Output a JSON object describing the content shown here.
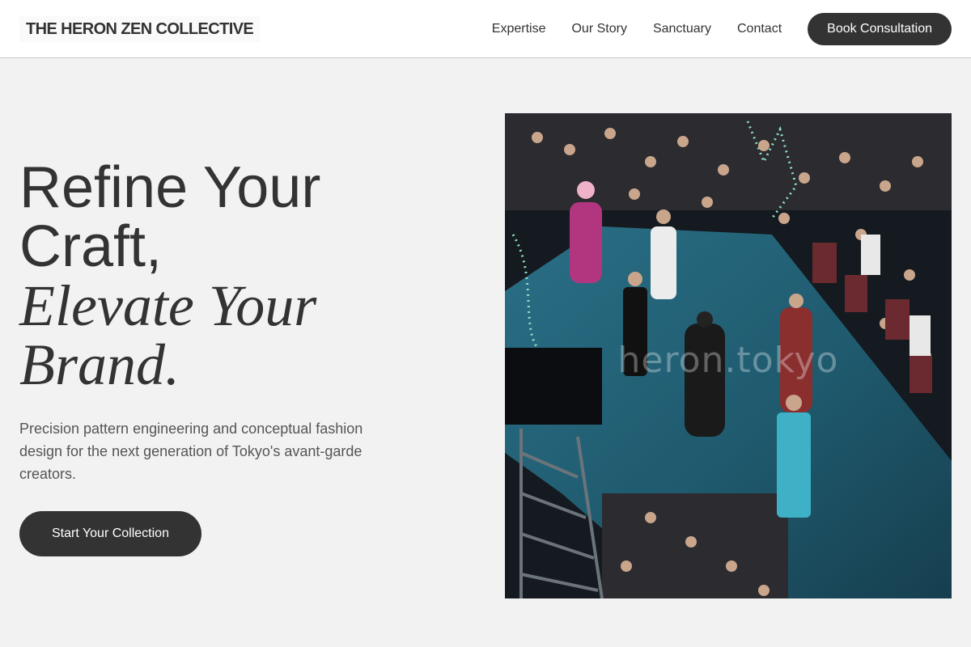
{
  "header": {
    "brand": "THE HERON ZEN COLLECTIVE",
    "nav": [
      "Expertise",
      "Our Story",
      "Sanctuary",
      "Contact"
    ],
    "cta_label": "Book Consultation"
  },
  "hero": {
    "headline_line1": "Refine Your Craft,",
    "headline_line2": "Elevate Your Brand.",
    "description": "Precision pattern engineering and conceptual fashion design for the next generation of Tokyo's avant-garde creators.",
    "cta_label": "Start Your Collection"
  },
  "image": {
    "watermark": "heron.tokyo",
    "subject": "fashion-runway-photo"
  },
  "colors": {
    "background": "#f2f2f2",
    "header": "#ffffff",
    "button": "#333333",
    "text": "#333333",
    "muted_text": "#555555"
  }
}
